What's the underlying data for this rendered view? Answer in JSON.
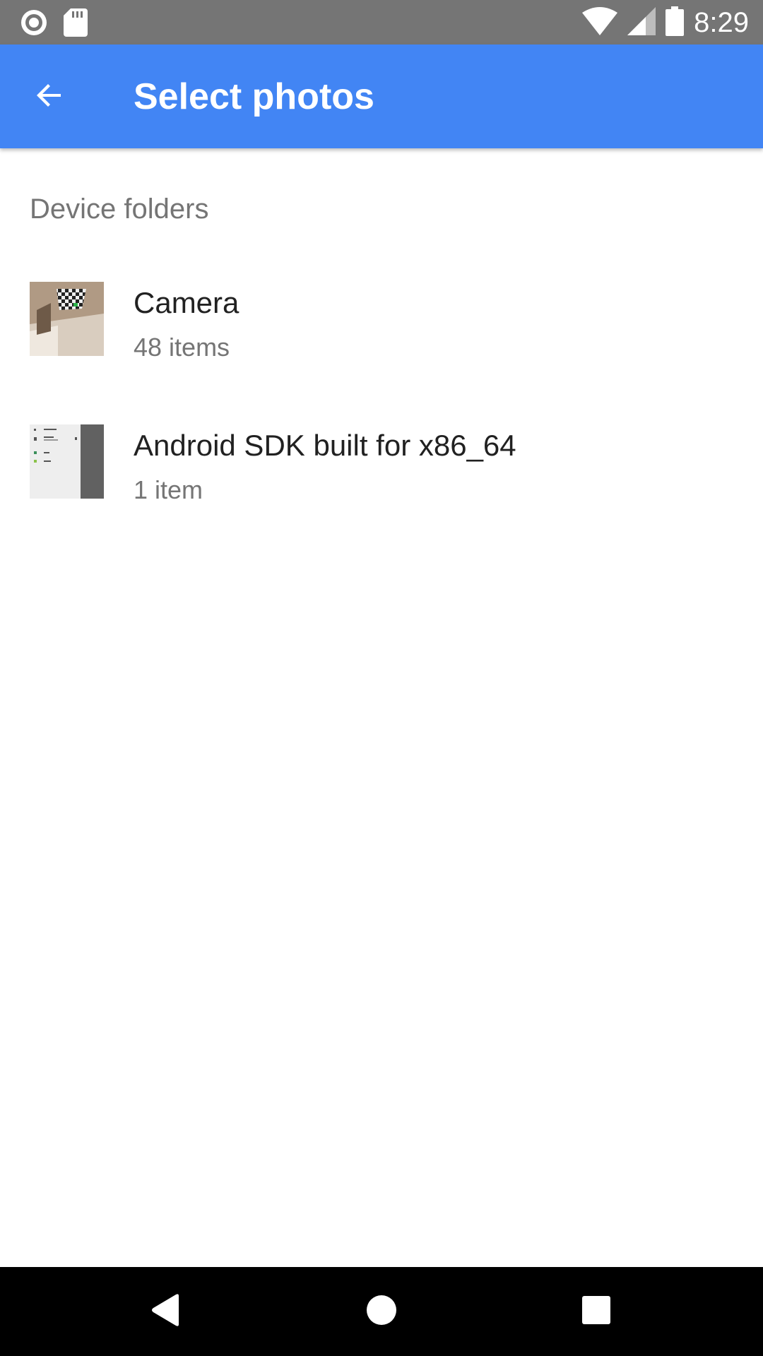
{
  "status_bar": {
    "time": "8:29",
    "icons_left": [
      "record-icon",
      "sd-card-icon"
    ],
    "icons_right": [
      "wifi-icon",
      "signal-icon",
      "battery-icon"
    ],
    "background": "#757575"
  },
  "app_bar": {
    "title": "Select photos",
    "back_icon": "arrow-back-icon",
    "background": "#4285f4"
  },
  "section": {
    "header": "Device folders"
  },
  "folders": [
    {
      "name": "Camera",
      "count": "48 items",
      "thumbnail": "camera-folder-thumbnail"
    },
    {
      "name": "Android SDK built for x86_64",
      "count": "1 item",
      "thumbnail": "screenshot-folder-thumbnail"
    }
  ],
  "nav_bar": {
    "icons": [
      "nav-back-icon",
      "nav-home-icon",
      "nav-recents-icon"
    ],
    "background": "#000000"
  }
}
